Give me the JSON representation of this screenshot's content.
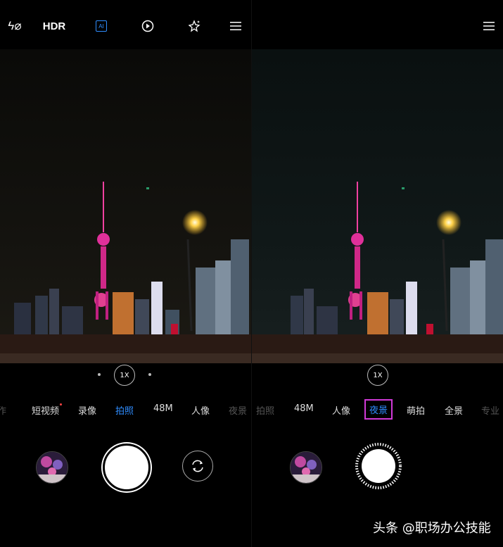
{
  "left": {
    "topbar": {
      "flash_label": "ϟ⌀",
      "hdr_label": "HDR",
      "ai_label": "AI"
    },
    "zoom_label": "1X",
    "modes": [
      {
        "label": "作",
        "state": "dim"
      },
      {
        "label": "短视频",
        "state": "normal",
        "dot": true
      },
      {
        "label": "录像",
        "state": "normal"
      },
      {
        "label": "拍照",
        "state": "active"
      },
      {
        "label": "48M",
        "state": "normal"
      },
      {
        "label": "人像",
        "state": "normal"
      },
      {
        "label": "夜景",
        "state": "dim"
      }
    ]
  },
  "right": {
    "zoom_label": "1X",
    "modes": [
      {
        "label": "拍照",
        "state": "dim"
      },
      {
        "label": "48M",
        "state": "normal"
      },
      {
        "label": "人像",
        "state": "normal"
      },
      {
        "label": "夜景",
        "state": "boxed"
      },
      {
        "label": "萌拍",
        "state": "normal"
      },
      {
        "label": "全景",
        "state": "normal"
      },
      {
        "label": "专业",
        "state": "dim"
      }
    ]
  },
  "watermark": "头条 @职场办公技能",
  "colors": {
    "active_mode": "#2f8dff",
    "highlight_box": "#d23ad8",
    "ai_icon": "#2f8dff"
  }
}
